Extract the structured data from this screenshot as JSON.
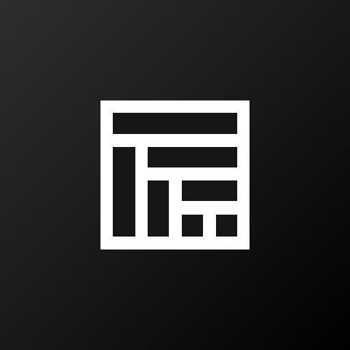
{
  "app_icon": {
    "icon": "layout-grid-icon",
    "background": {
      "gradient_start": "#2e2e2e",
      "gradient_end": "#000000"
    },
    "glyph_color": "#ffffff",
    "panel_color": "#161616"
  }
}
